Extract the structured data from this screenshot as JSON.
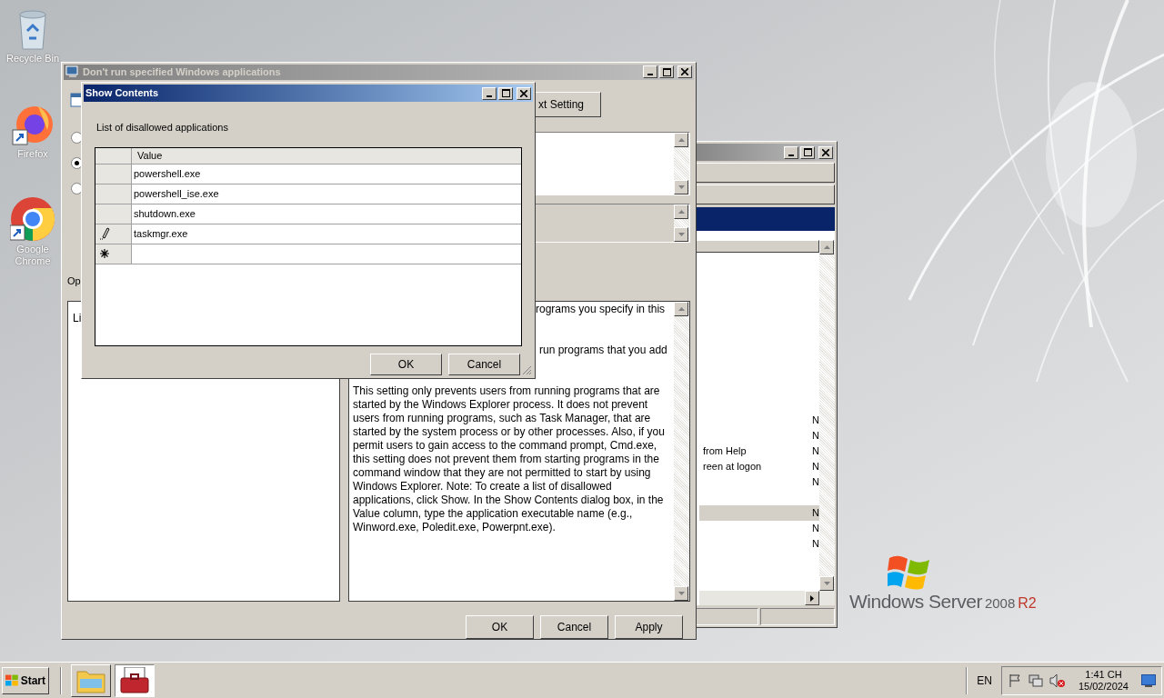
{
  "desktop_icons": [
    {
      "label": "Recycle Bin",
      "kind": "recycle"
    },
    {
      "label": "Firefox",
      "kind": "firefox"
    },
    {
      "label": "Google Chrome",
      "kind": "chrome"
    }
  ],
  "logo": {
    "product": "Windows Server",
    "version": "2008",
    "edition": "R2"
  },
  "background_window": {
    "rows": [
      {
        "name": null,
        "state": "N",
        "selected": false
      },
      {
        "name": null,
        "state": "N",
        "selected": false
      },
      {
        "name": "from Help",
        "state": "N",
        "selected": false
      },
      {
        "name": "reen at logon",
        "state": "N",
        "selected": false
      },
      {
        "name": null,
        "state": "N",
        "selected": false
      },
      {
        "name": null,
        "state": null,
        "selected": false
      },
      {
        "name": null,
        "state": "N",
        "selected": true
      },
      {
        "name": null,
        "state": "N",
        "selected": false
      },
      {
        "name": null,
        "state": "N",
        "selected": false
      }
    ]
  },
  "main_window": {
    "title": "Don't run specified Windows applications",
    "active": false,
    "radios": [
      {
        "selected": false
      },
      {
        "selected": true
      },
      {
        "selected": false
      }
    ],
    "next_button": "xt Setting",
    "options_label": "Op",
    "options_text": "Li",
    "help_fragments": [
      "rograms you specify in this",
      "run programs that you add"
    ],
    "help_paragraph": "This setting only prevents users from running programs that are started by the Windows Explorer process. It does not prevent users from running programs, such as Task Manager, that are started by the system process or by other processes. Also, if you permit users to gain access to the command prompt, Cmd.exe, this setting does not prevent them from starting programs in the command window that they are not permitted to start by using Windows Explorer. Note: To create a list of disallowed applications, click Show. In the Show Contents dialog box, in the Value column, type the application executable name (e.g., Winword.exe, Poledit.exe, Powerpnt.exe).",
    "buttons": [
      "OK",
      "Cancel",
      "Apply"
    ]
  },
  "show_contents": {
    "title": "Show Contents",
    "active": true,
    "label": "List of disallowed applications",
    "column": "Value",
    "rows": [
      {
        "value": "powershell.exe",
        "kind": "plain"
      },
      {
        "value": "powershell_ise.exe",
        "kind": "plain"
      },
      {
        "value": "shutdown.exe",
        "kind": "plain"
      },
      {
        "value": "taskmgr.exe",
        "kind": "editing"
      },
      {
        "value": null,
        "kind": "new"
      }
    ],
    "buttons": [
      "OK",
      "Cancel"
    ]
  },
  "taskbar": {
    "start": "Start",
    "apps": [
      {
        "kind": "explorer",
        "selected": false
      },
      {
        "kind": "toolbox",
        "selected": true
      }
    ],
    "language": "EN",
    "time": "1:41 CH",
    "date": "15/02/2024"
  }
}
